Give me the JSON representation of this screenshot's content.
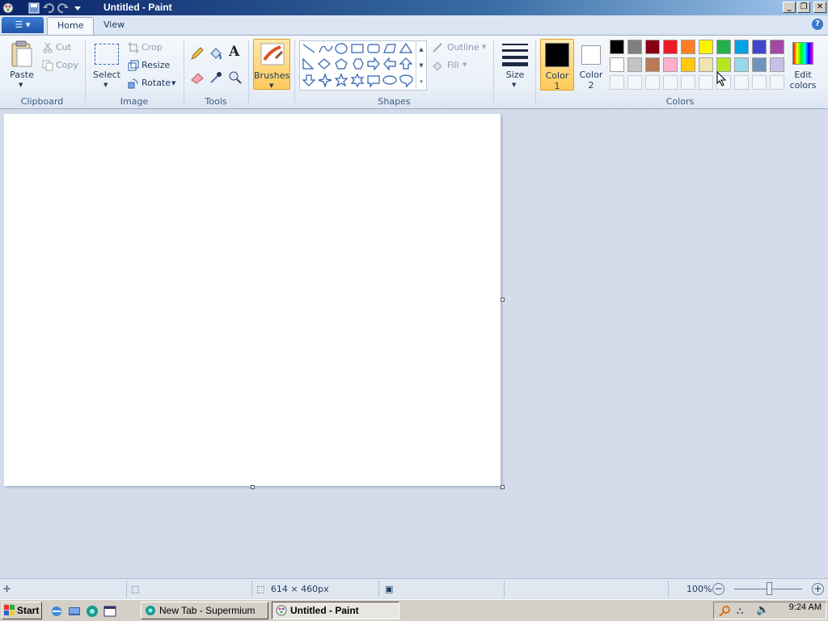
{
  "window": {
    "title": "Untitled - Paint"
  },
  "tabs": [
    {
      "label": "Home"
    },
    {
      "label": "View"
    }
  ],
  "clipboard": {
    "paste": "Paste",
    "cut": "Cut",
    "copy": "Copy",
    "group": "Clipboard"
  },
  "image": {
    "select": "Select",
    "crop": "Crop",
    "resize": "Resize",
    "rotate": "Rotate",
    "group": "Image"
  },
  "tools": {
    "group": "Tools",
    "text_glyph": "A"
  },
  "brushes": {
    "label": "Brushes"
  },
  "shapes": {
    "group": "Shapes",
    "outline": "Outline",
    "fill": "Fill"
  },
  "size": {
    "label": "Size"
  },
  "colors": {
    "group": "Colors",
    "color1_label": "Color",
    "color1_num": "1",
    "color2_label": "Color",
    "color2_num": "2",
    "edit_label": "Edit",
    "edit_label2": "colors",
    "color1": "#000000",
    "color2": "#ffffff",
    "palette_row1": [
      "#000000",
      "#7f7f7f",
      "#880015",
      "#ed1c24",
      "#ff7f27",
      "#fff200",
      "#22b14c",
      "#00a2e8",
      "#3f48cc",
      "#a349a4"
    ],
    "palette_row2": [
      "#ffffff",
      "#c3c3c3",
      "#b97a57",
      "#ffaec9",
      "#ffc90e",
      "#efe4b0",
      "#b5e61d",
      "#99d9ea",
      "#7092be",
      "#c8bfe7"
    ]
  },
  "status": {
    "dimensions": "614 × 460px",
    "zoom": "100%"
  },
  "taskbar": {
    "start": "Start",
    "items": [
      {
        "label": "New Tab - Supermium"
      },
      {
        "label": "Untitled - Paint"
      }
    ],
    "clock": "9:24 AM"
  }
}
